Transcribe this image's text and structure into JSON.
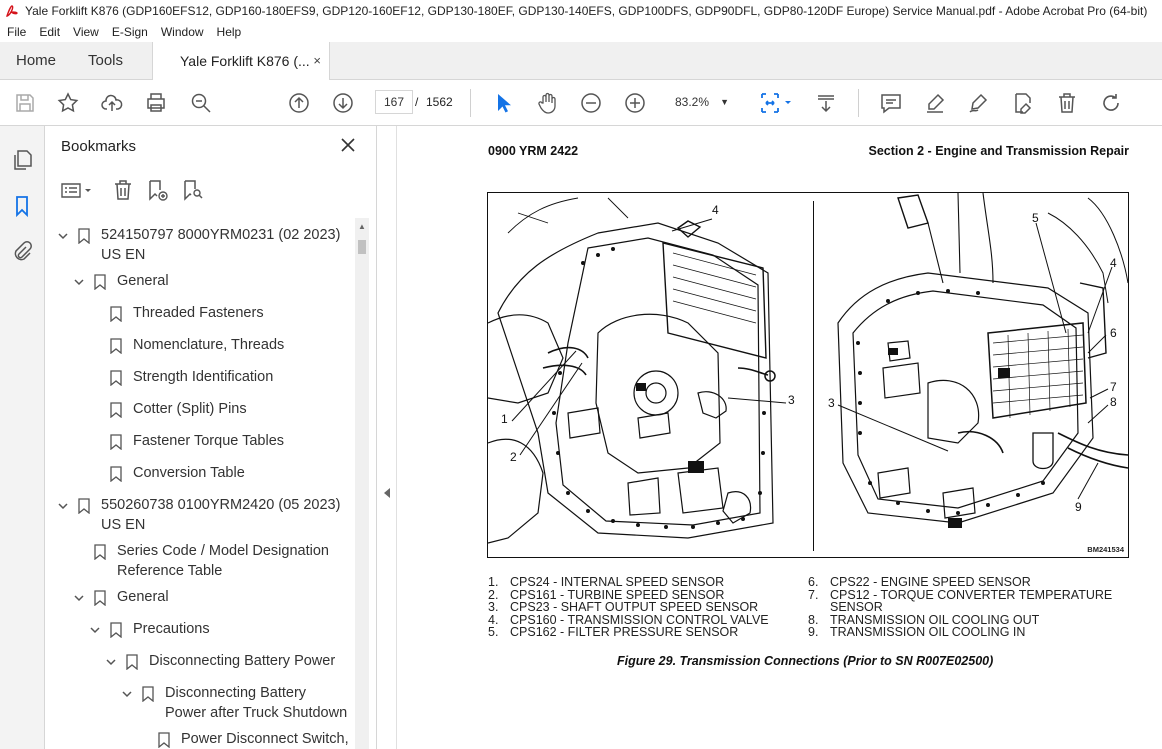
{
  "window": {
    "title": "Yale Forklift K876 (GDP160EFS12, GDP160-180EFS9, GDP120-160EF12, GDP130-180EF, GDP130-140EFS, GDP100DFS, GDP90DFL, GDP80-120DF Europe) Service Manual.pdf - Adobe Acrobat Pro (64-bit)"
  },
  "menu": [
    "File",
    "Edit",
    "View",
    "E-Sign",
    "Window",
    "Help"
  ],
  "tabs": {
    "home": "Home",
    "tools": "Tools",
    "document": "Yale Forklift K876 (...",
    "close": "×"
  },
  "toolbar": {
    "current_page": "167",
    "separator": "/",
    "total_pages": "1562",
    "zoom": "83.2%"
  },
  "bookmarks": {
    "title": "Bookmarks",
    "items": [
      {
        "label": "524150797 8000YRM0231 (02 2023)",
        "label2": "US EN",
        "level": 0,
        "expanded": true
      },
      {
        "label": "General",
        "level": 1,
        "expanded": true
      },
      {
        "label": "Threaded Fasteners",
        "level": 2
      },
      {
        "label": "Nomenclature, Threads",
        "level": 2
      },
      {
        "label": "Strength Identification",
        "level": 2
      },
      {
        "label": "Cotter (Split) Pins",
        "level": 2
      },
      {
        "label": "Fastener Torque Tables",
        "level": 2
      },
      {
        "label": "Conversion Table",
        "level": 2
      },
      {
        "label": "550260738 0100YRM2420 (05 2023)",
        "label2": "US EN",
        "level": 0,
        "expanded": true
      },
      {
        "label": "Series Code / Model Designation",
        "label2": "Reference Table",
        "level": 1
      },
      {
        "label": "General",
        "level": 1,
        "expanded": true
      },
      {
        "label": "Precautions",
        "level": 2,
        "expanded": true
      },
      {
        "label": "Disconnecting Battery Power",
        "level": 3,
        "expanded": true
      },
      {
        "label": "Disconnecting Battery",
        "label2": "Power after Truck Shutdown",
        "level": 4,
        "expanded": true
      },
      {
        "label": "Power Disconnect Switch,",
        "level": 5
      }
    ]
  },
  "document": {
    "header_left": "0900 YRM 2422",
    "header_right": "Section 2 - Engine and Transmission Repair",
    "figure_id": "BM241534",
    "callouts_left": [
      "4",
      "3",
      "1",
      "2"
    ],
    "callouts_right": [
      "5",
      "4",
      "6",
      "7",
      "8",
      "3",
      "9"
    ],
    "legend": [
      {
        "num": "1.",
        "text": "CPS24 - INTERNAL SPEED SENSOR"
      },
      {
        "num": "2.",
        "text": "CPS161 - TURBINE SPEED SENSOR"
      },
      {
        "num": "3.",
        "text": "CPS23 - SHAFT OUTPUT SPEED SENSOR"
      },
      {
        "num": "4.",
        "text": "CPS160 - TRANSMISSION CONTROL VALVE"
      },
      {
        "num": "5.",
        "text": "CPS162 - FILTER PRESSURE SENSOR"
      },
      {
        "num": "6.",
        "text": "CPS22 - ENGINE SPEED SENSOR"
      },
      {
        "num": "7.",
        "text": "CPS12 - TORQUE CONVERTER TEMPERATURE"
      },
      {
        "num": "",
        "text": "SENSOR"
      },
      {
        "num": "8.",
        "text": "TRANSMISSION OIL COOLING OUT"
      },
      {
        "num": "9.",
        "text": "TRANSMISSION OIL COOLING IN"
      }
    ],
    "caption": "Figure 29. Transmission Connections (Prior to SN R007E02500)"
  }
}
